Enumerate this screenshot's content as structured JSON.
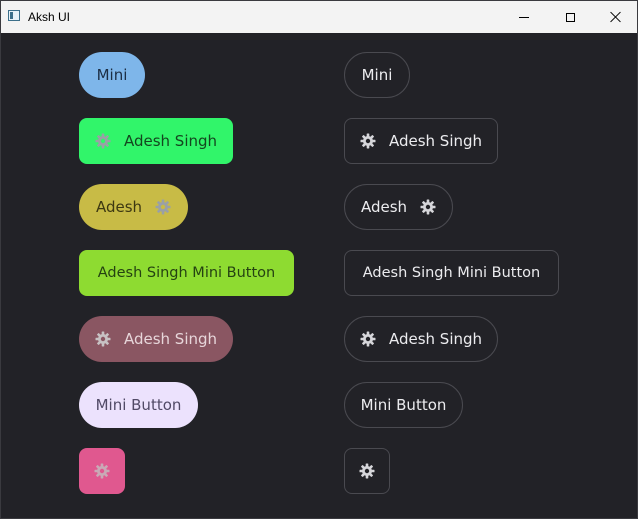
{
  "window": {
    "title": "Aksh UI"
  },
  "icons": {
    "app": "app-icon",
    "minimize": "minimize-icon",
    "maximize": "maximize-icon",
    "close": "close-icon",
    "button_icon": "gear-icon"
  },
  "colors": {
    "background": "#222227",
    "blue": "#7eb6ea",
    "green": "#31f56a",
    "olive": "#c8bb46",
    "lime": "#8edb31",
    "mauve": "#8a5662",
    "lavender": "#ece2fd",
    "pink": "#e0588f"
  },
  "filled_buttons": [
    {
      "label": "Mini"
    },
    {
      "label": "Adesh Singh"
    },
    {
      "label": "Adesh"
    },
    {
      "label": "Adesh Singh Mini Button"
    },
    {
      "label": "Adesh Singh"
    },
    {
      "label": "Mini Button"
    },
    {
      "label": ""
    }
  ],
  "outline_buttons": [
    {
      "label": "Mini"
    },
    {
      "label": "Adesh Singh"
    },
    {
      "label": "Adesh"
    },
    {
      "label": "Adesh Singh Mini Button"
    },
    {
      "label": "Adesh Singh"
    },
    {
      "label": "Mini Button"
    },
    {
      "label": ""
    }
  ]
}
